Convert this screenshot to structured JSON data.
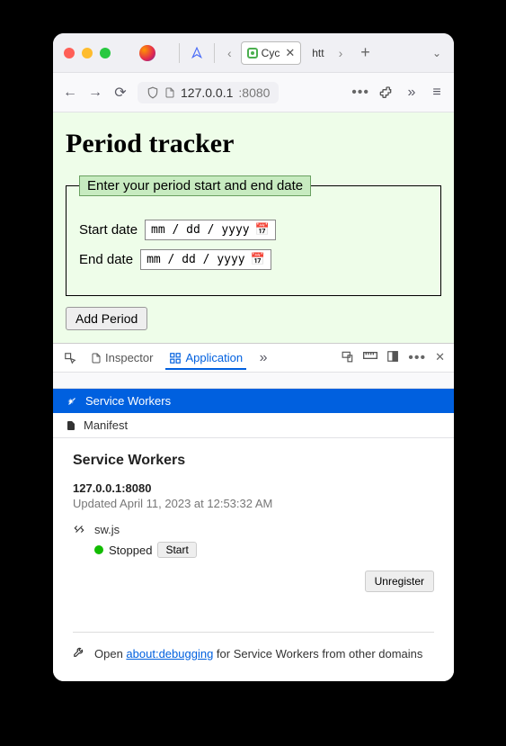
{
  "tabs": {
    "active_label": "Cyc",
    "inactive_label": "htt"
  },
  "urlbar": {
    "host": "127.0.0.1",
    "port": ":8080"
  },
  "page": {
    "title": "Period tracker",
    "legend": "Enter your period start and end date",
    "start_label": "Start date",
    "end_label": "End date",
    "date_placeholder": "mm / dd / yyyy",
    "add_button": "Add Period"
  },
  "devtools": {
    "inspector_tab": "Inspector",
    "application_tab": "Application",
    "service_workers": "Service Workers",
    "manifest": "Manifest",
    "body_title": "Service Workers",
    "host": "127.0.0.1:8080",
    "updated": "Updated April 11, 2023 at 12:53:32 AM",
    "sw_file": "sw.js",
    "status": "Stopped",
    "start_button": "Start",
    "unregister": "Unregister",
    "footer_prefix": "Open ",
    "footer_link": "about:debugging",
    "footer_suffix": " for Service Workers from other domains"
  }
}
